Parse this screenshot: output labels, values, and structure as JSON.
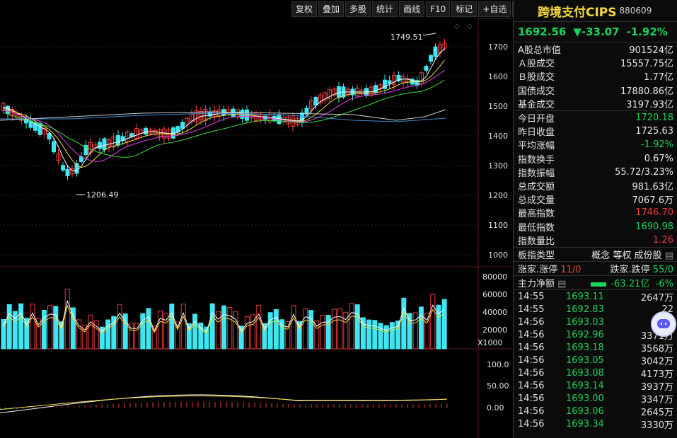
{
  "toolbar": [
    "复权",
    "叠加",
    "多股",
    "统计",
    "画线",
    "F10",
    "标记",
    "+自选",
    "返回"
  ],
  "price_axis": [
    "1700",
    "1600",
    "1500",
    "1400",
    "1300",
    "1200",
    "1100",
    "1000"
  ],
  "volume_axis": [
    "80000",
    "60000",
    "40000",
    "20000"
  ],
  "volume_unit": "X1000",
  "macd_axis": [
    "100.0",
    "50.00",
    "0.00"
  ],
  "annotations": {
    "high": "1749.51",
    "low": "1206.49"
  },
  "header": {
    "name": "跨境支付CIPS",
    "code": "880609"
  },
  "quote": {
    "price": "1692.56",
    "change": "▼-33.07",
    "pct": "-1.92%"
  },
  "stats_group1": [
    {
      "label": "A股总市值",
      "value": "901524亿",
      "color": "#e8e8e8"
    },
    {
      "label": "Ａ股成交",
      "value": "15557.75亿",
      "color": "#e8e8e8"
    },
    {
      "label": "Ｂ股成交",
      "value": "1.77亿",
      "color": "#e8e8e8"
    },
    {
      "label": "国债成交",
      "value": "17880.86亿",
      "color": "#e8e8e8"
    },
    {
      "label": "基金成交",
      "value": "3197.93亿",
      "color": "#e8e8e8"
    }
  ],
  "stats_group2": [
    {
      "label": "今日开盘",
      "value": "1720.18",
      "color": "#19d35a"
    },
    {
      "label": "昨日收盘",
      "value": "1725.63",
      "color": "#e8e8e8"
    },
    {
      "label": "平均涨幅",
      "value": "-1.92%",
      "color": "#19d35a"
    },
    {
      "label": "指数换手",
      "value": "0.67%",
      "color": "#e8e8e8"
    },
    {
      "label": "指数振幅",
      "value": "55.72/3.23%",
      "color": "#e8e8e8"
    },
    {
      "label": "总成交额",
      "value": "981.63亿",
      "color": "#e8e8e8"
    },
    {
      "label": "总成交量",
      "value": "7067.6万",
      "color": "#e8e8e8"
    },
    {
      "label": "最高指数",
      "value": "1746.70",
      "color": "#f03a3a"
    },
    {
      "label": "最低指数",
      "value": "1690.98",
      "color": "#19d35a"
    },
    {
      "label": "指数量比",
      "value": "1.26",
      "color": "#f03a3a"
    }
  ],
  "sector": {
    "label": "板指类型",
    "value": "概念 等权 成份股"
  },
  "breadth": {
    "up_label": "涨家.涨停",
    "up_value": "11/0",
    "down_label": "跌家.跌停",
    "down_value": "55/0"
  },
  "mainflow": {
    "label": "主力净额",
    "value": "-63.21亿",
    "pct": "-6%"
  },
  "ticks": [
    {
      "time": "14:55",
      "price": "1693.11",
      "vol": "2647万"
    },
    {
      "time": "14:55",
      "price": "1692.83",
      "vol": "22"
    },
    {
      "time": "14:56",
      "price": "1693.03",
      "vol": "29"
    },
    {
      "time": "14:56",
      "price": "1692.96",
      "vol": "3371万"
    },
    {
      "time": "14:56",
      "price": "1693.18",
      "vol": "3568万"
    },
    {
      "time": "14:56",
      "price": "1693.05",
      "vol": "3042万"
    },
    {
      "time": "14:56",
      "price": "1693.08",
      "vol": "4173万"
    },
    {
      "time": "14:56",
      "price": "1693.14",
      "vol": "3937万"
    },
    {
      "time": "14:56",
      "price": "1693.00",
      "vol": "3347万"
    },
    {
      "time": "14:56",
      "price": "1693.06",
      "vol": "2645万"
    },
    {
      "time": "14:56",
      "price": "1693.34",
      "vol": "3330万"
    }
  ],
  "colors": {
    "up": "#f03a3a",
    "down": "#3ee6f2",
    "accent": "#f5d83c",
    "green": "#19d35a"
  }
}
